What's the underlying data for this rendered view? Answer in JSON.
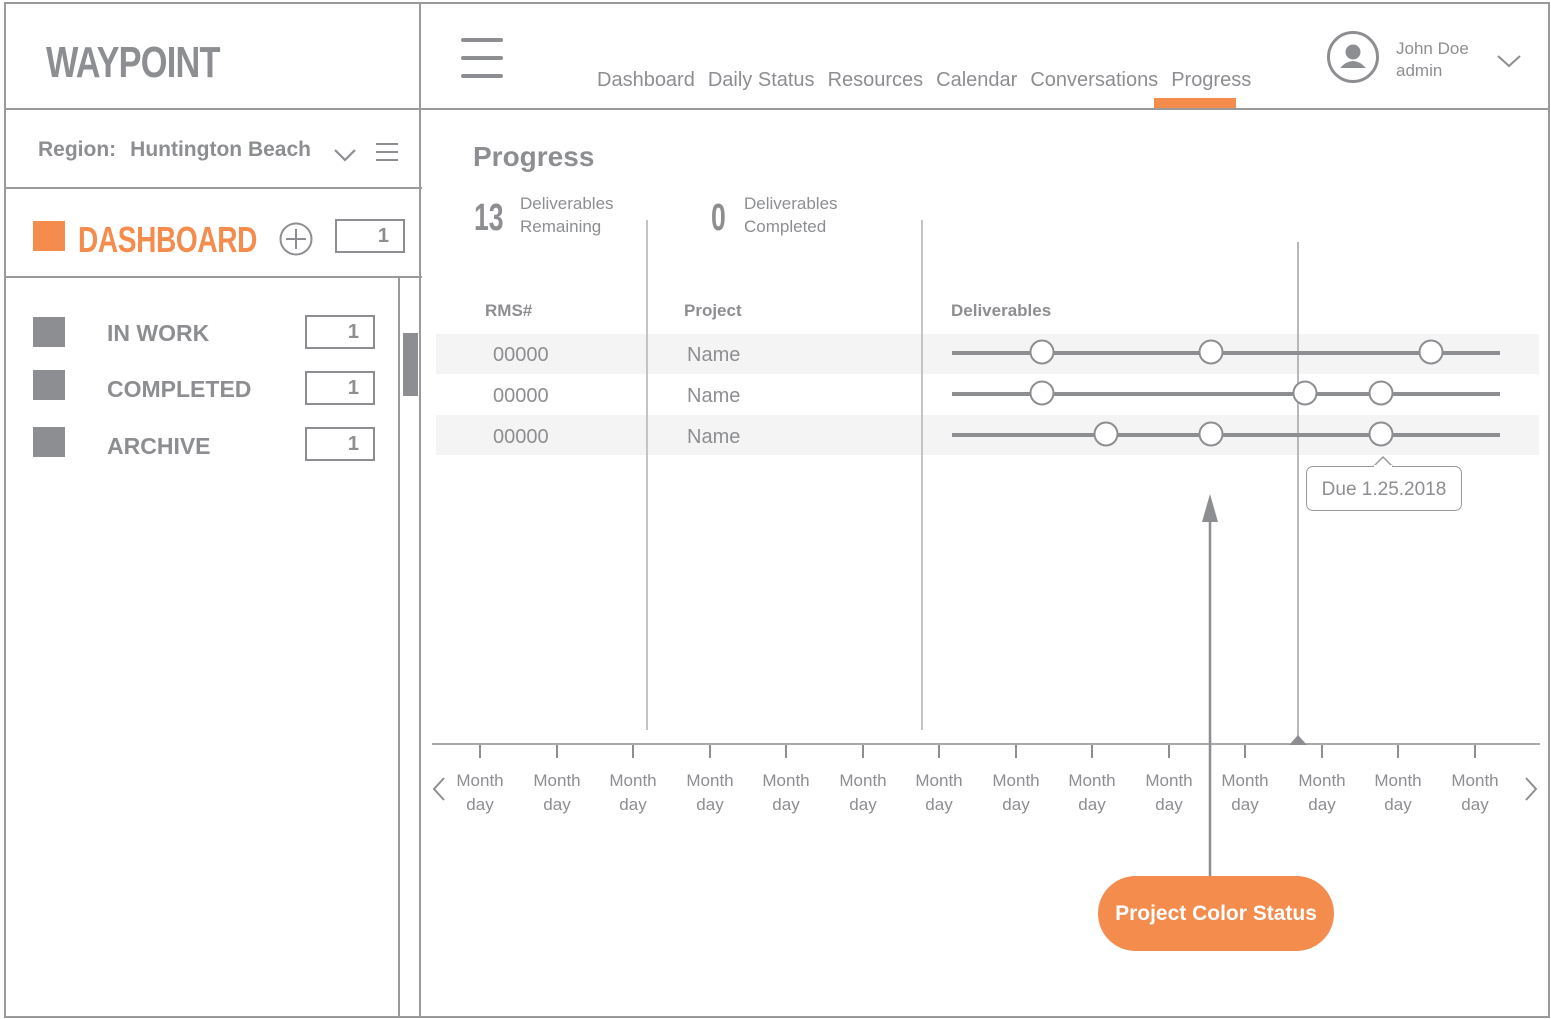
{
  "app": {
    "logo": "WAYPOINT"
  },
  "sidebar": {
    "region_label": "Region:",
    "region_value": "Huntington Beach",
    "dashboard_label": "DASHBOARD",
    "dashboard_count": "1",
    "categories": [
      {
        "label": "IN WORK",
        "count": "1"
      },
      {
        "label": "COMPLETED",
        "count": "1"
      },
      {
        "label": "ARCHIVE",
        "count": "1"
      }
    ]
  },
  "nav": {
    "items": [
      "Dashboard",
      "Daily Status",
      "Resources",
      "Calendar",
      "Conversations",
      "Progress"
    ],
    "active": "Progress"
  },
  "user": {
    "name": "John Doe",
    "role": "admin"
  },
  "main": {
    "title": "Progress",
    "stats": [
      {
        "value": "13",
        "label_line1": "Deliverables",
        "label_line2": "Remaining"
      },
      {
        "value": "0",
        "label_line1": "Deliverables",
        "label_line2": "Completed"
      }
    ],
    "columns": [
      "RMS#",
      "Project",
      "Deliverables"
    ],
    "rows": [
      {
        "rms": "00000",
        "project": "Name"
      },
      {
        "rms": "00000",
        "project": "Name"
      },
      {
        "rms": "00000",
        "project": "Name"
      }
    ],
    "tooltip": "Due 1.25.2018",
    "timeline_ticks": [
      {
        "month": "Month",
        "day": "day"
      },
      {
        "month": "Month",
        "day": "day"
      },
      {
        "month": "Month",
        "day": "day"
      },
      {
        "month": "Month",
        "day": "day"
      },
      {
        "month": "Month",
        "day": "day"
      },
      {
        "month": "Month",
        "day": "day"
      },
      {
        "month": "Month",
        "day": "day"
      },
      {
        "month": "Month",
        "day": "day"
      },
      {
        "month": "Month",
        "day": "day"
      },
      {
        "month": "Month",
        "day": "day"
      },
      {
        "month": "Month",
        "day": "day"
      },
      {
        "month": "Month",
        "day": "day"
      },
      {
        "month": "Month",
        "day": "day"
      },
      {
        "month": "Month",
        "day": "day"
      }
    ],
    "callout": "Project Color Status"
  },
  "colors": {
    "accent": "#f48c4d",
    "neutral": "#8d8e91"
  }
}
